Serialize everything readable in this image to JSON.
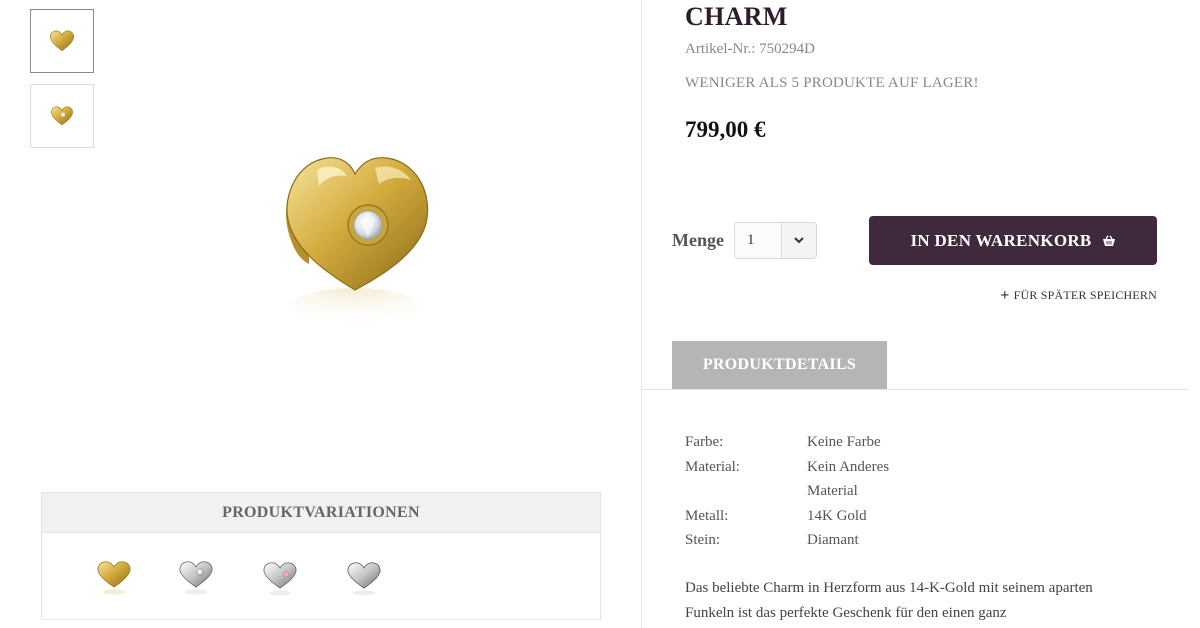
{
  "product": {
    "title": "CHARM",
    "sku_label": "Artikel-Nr.:",
    "sku_value": "750294D",
    "stock_notice": "WENIGER ALS 5 PRODUKTE AUF LAGER!",
    "price": "799,00 €"
  },
  "purchase": {
    "quantity_label": "Menge",
    "quantity_value": "1",
    "add_to_cart_label": "IN DEN WARENKORB",
    "save_later_label": "FÜR SPÄTER SPEICHERN"
  },
  "tabs": {
    "details_label": "PRODUKTDETAILS"
  },
  "details": {
    "specs": [
      {
        "label": "Farbe:",
        "value": "Keine Farbe"
      },
      {
        "label": "Material:",
        "value": "Kein Anderes Material"
      },
      {
        "label": "Metall:",
        "value": "14K Gold"
      },
      {
        "label": "Stein:",
        "value": "Diamant"
      }
    ],
    "description": "Das beliebte Charm in Herzform aus 14-K-Gold mit seinem aparten Funkeln ist das perfekte Geschenk für den einen ganz"
  },
  "variations": {
    "heading": "PRODUKTVARIATIONEN",
    "items": [
      "gold-heart-charm",
      "silver-heart-charm-clear-stone",
      "silver-heart-charm-pink-stone",
      "silver-heart-charm-plain"
    ]
  },
  "colors": {
    "cart_button": "#3e2a3c",
    "tab_active": "#b5b5b5",
    "gold": "#d8b54a",
    "silver": "#c8c8c8"
  }
}
